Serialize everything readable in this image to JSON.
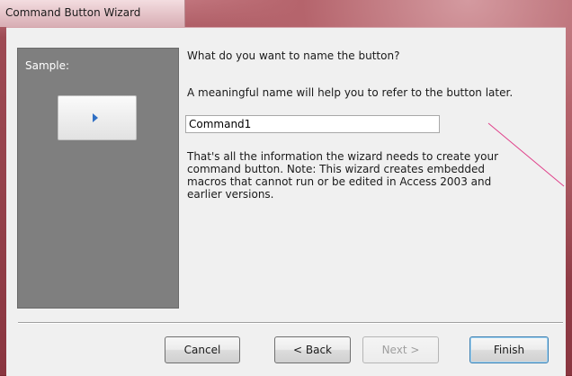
{
  "window": {
    "title": "Command Button Wizard"
  },
  "sample": {
    "label": "Sample:",
    "button_icon": "play-arrow-icon"
  },
  "wizard": {
    "prompt": "What do you want to name the button?",
    "hint": "A meaningful name will help you to refer to the button later.",
    "name_value": "Command1",
    "info": "That's all the information the wizard needs to create your\ncommand button. Note: This wizard creates embedded\nmacros that cannot run or be edited in Access 2003 and\nearlier versions."
  },
  "buttons": {
    "cancel": "Cancel",
    "back": "< Back",
    "next": "Next >",
    "finish": "Finish"
  },
  "colors": {
    "sample_panel": "#7f7f7f",
    "arrow": "#2f6fc4",
    "annotation_line": "#e0408a"
  }
}
